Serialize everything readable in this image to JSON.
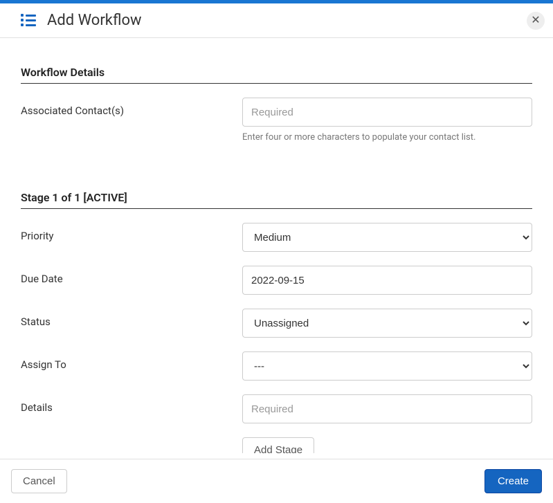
{
  "header": {
    "title": "Add Workflow"
  },
  "sections": {
    "details": {
      "title": "Workflow Details",
      "contacts": {
        "label": "Associated Contact(s)",
        "placeholder": "Required",
        "helper": "Enter four or more characters to populate your contact list."
      }
    },
    "stage": {
      "title": "Stage 1 of 1 [ACTIVE]",
      "priority": {
        "label": "Priority",
        "value": "Medium"
      },
      "due_date": {
        "label": "Due Date",
        "value": "2022-09-15"
      },
      "status": {
        "label": "Status",
        "value": "Unassigned"
      },
      "assign_to": {
        "label": "Assign To",
        "value": "---"
      },
      "details_field": {
        "label": "Details",
        "placeholder": "Required"
      },
      "add_stage_btn": "Add Stage"
    }
  },
  "footer": {
    "cancel": "Cancel",
    "create": "Create"
  }
}
